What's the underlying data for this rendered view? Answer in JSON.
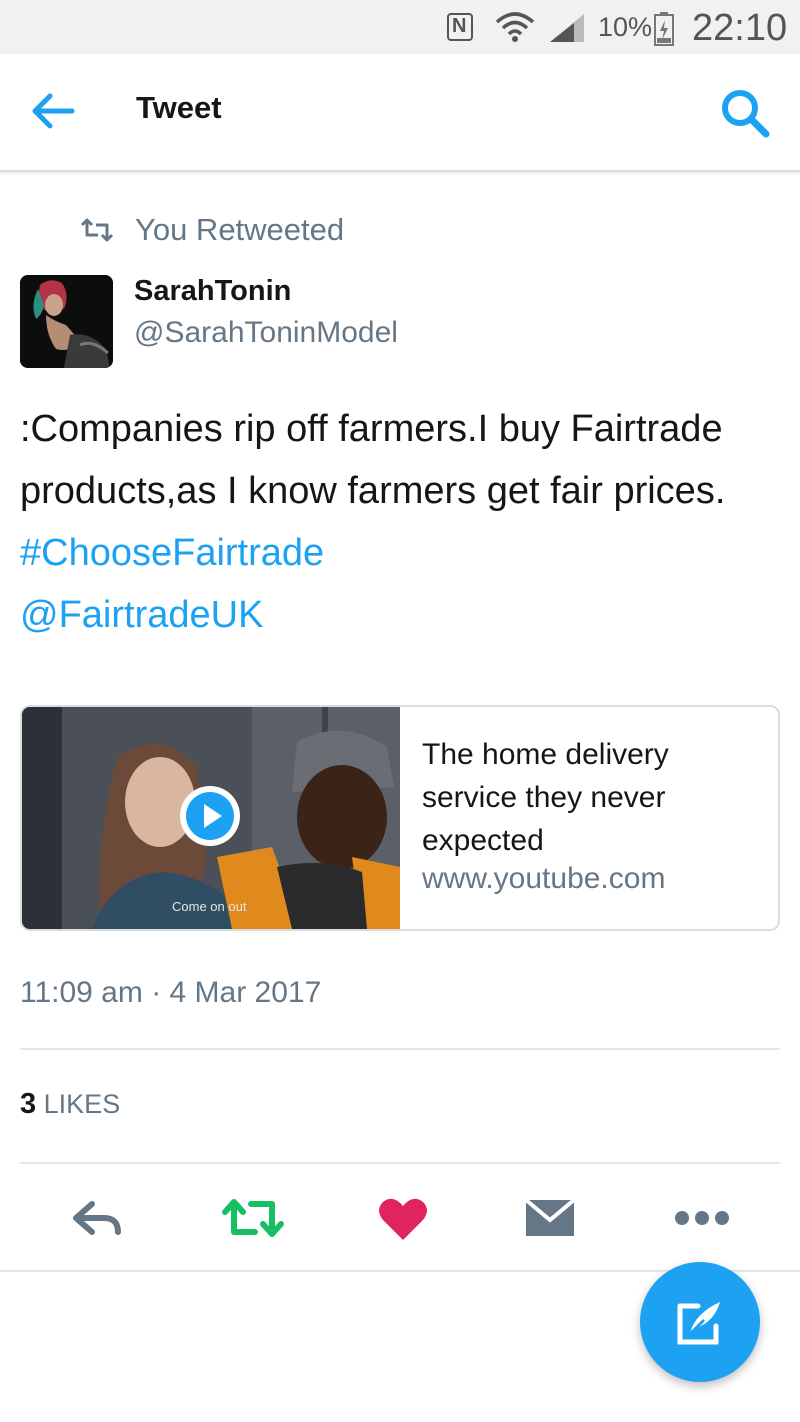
{
  "status_bar": {
    "battery_percent": "10%",
    "time": "22:10",
    "nfc": "N"
  },
  "header": {
    "title": "Tweet"
  },
  "retweet": {
    "text": "You Retweeted"
  },
  "author": {
    "name": "SarahTonin",
    "handle": "@SarahToninModel"
  },
  "tweet": {
    "text_main": ":Companies rip off farmers.I buy Fairtrade products,as I know farmers get fair prices. ",
    "hashtag": "#ChooseFairtrade",
    "mention": "@FairtradeUK"
  },
  "card": {
    "title": "The home delivery service they never expected",
    "url": "www.youtube.com",
    "thumb_caption": "Come on out"
  },
  "timestamp": "11:09 am · 4 Mar 2017",
  "likes": {
    "count": "3",
    "label": "LIKES"
  },
  "icons": {
    "back": "arrow-left-icon",
    "search": "search-icon",
    "retweet": "retweet-icon",
    "reply": "reply-icon",
    "like": "heart-icon",
    "dm": "envelope-icon",
    "more": "more-icon",
    "compose": "compose-icon",
    "play": "play-icon"
  },
  "colors": {
    "accent": "#1da1f2",
    "retweet_green": "#17bf63",
    "like_red": "#e0245e",
    "muted": "#657786"
  }
}
